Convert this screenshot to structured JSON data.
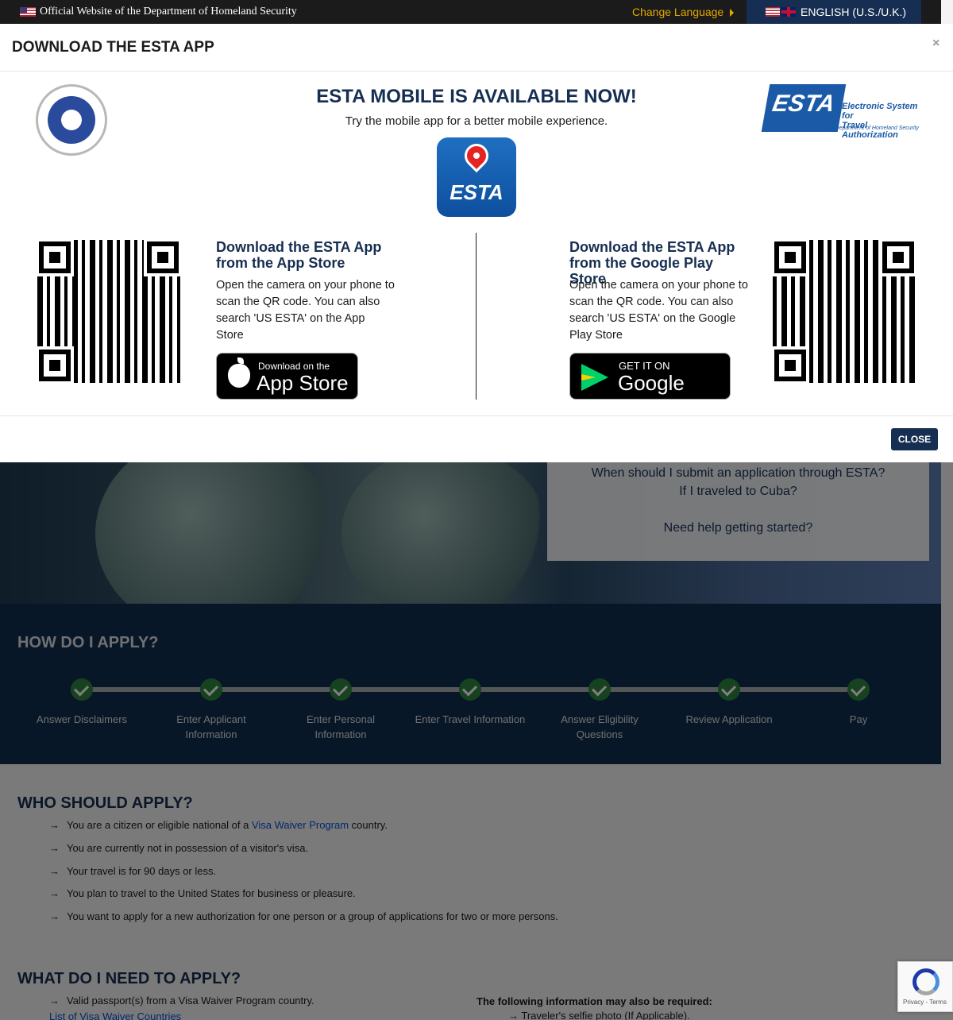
{
  "topbar": {
    "official_text": "Official Website of the Department of Homeland Security",
    "change_language": "Change Language",
    "language": "ENGLISH (U.S./U.K.)"
  },
  "faq": {
    "links": [
      "When should I submit an application through ESTA?",
      "If I traveled to Cuba?",
      "Need help getting started?"
    ]
  },
  "how_to_apply": {
    "title": "HOW DO I APPLY?",
    "steps": [
      "Answer Disclaimers",
      "Enter Applicant Information",
      "Enter Personal Information",
      "Enter Travel Information",
      "Answer Eligibility Questions",
      "Review Application",
      "Pay"
    ]
  },
  "who_should_apply": {
    "title": "WHO SHOULD APPLY?",
    "items": [
      {
        "before": "You are a citizen or eligible national of a ",
        "link": "Visa Waiver Program",
        "after": " country."
      },
      {
        "before": "You are currently not in possession of a visitor's visa.",
        "link": "",
        "after": ""
      },
      {
        "before": "Your travel is for 90 days or less.",
        "link": "",
        "after": ""
      },
      {
        "before": "You plan to travel to the United States for business or pleasure.",
        "link": "",
        "after": ""
      },
      {
        "before": "You want to apply for a new authorization for one person or a group of applications for two or more persons.",
        "link": "",
        "after": ""
      }
    ]
  },
  "what_need": {
    "title": "WHAT DO I NEED TO APPLY?",
    "item1": "Valid passport(s) from a Visa Waiver Program country.",
    "list_link": "List of Visa Waiver Countries",
    "also_title": "The following information may also be required:",
    "also_item1": "Traveler's selfie photo (If Applicable)."
  },
  "recaptcha": {
    "text": "Privacy - Terms"
  },
  "modal": {
    "title": "DOWNLOAD THE ESTA APP",
    "close_x": "×",
    "heading": "ESTA MOBILE IS AVAILABLE NOW!",
    "subheading": "Try the mobile app for a better mobile experience.",
    "app_icon_text": "ESTA",
    "esta_logo": {
      "mark": "ESTA",
      "line1": "Electronic System for",
      "line2": "Travel Authorization",
      "dept": "U.S. Department of Homeland Security"
    },
    "appstore": {
      "title": "Download the ESTA App from the App Store",
      "text": "Open the camera on your phone to scan the QR code. You can also search 'US ESTA' on the App Store",
      "btn_small": "Download on the",
      "btn_big": "App Store"
    },
    "googleplay": {
      "title": "Download the ESTA App from the Google Play Store",
      "text": "Open the camera on your phone to scan the QR code. You can also search 'US ESTA' on the Google Play Store",
      "btn_small": "GET IT ON",
      "btn_big": "Google Play"
    },
    "close_button": "CLOSE"
  }
}
